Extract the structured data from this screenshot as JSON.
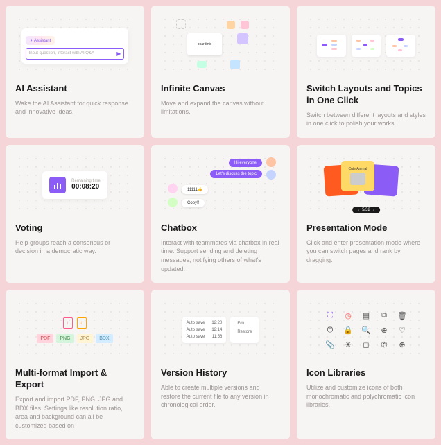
{
  "cards": {
    "ai": {
      "title": "AI Assistant",
      "desc": "Wake the AI Assistant for quick response and innovative ideas.",
      "chip": "✦ Assistant",
      "placeholder": "Input question, interact with AI Q&A"
    },
    "canvas": {
      "title": "Infinite Canvas",
      "desc": "Move and expand the canvas without limitations.",
      "center_label": "boardmix"
    },
    "layouts": {
      "title": "Switch Layouts and Topics in One Click",
      "desc": "Switch between different layouts and styles in one click to polish your works."
    },
    "voting": {
      "title": "Voting",
      "desc": "Help groups reach a consensus or decision in a democratic way.",
      "label": "Remaining time",
      "time": "00:08:20"
    },
    "chatbox": {
      "title": "Chatbox",
      "desc": "Interact with teammates via chatbox in real time. Support sending and deleting messages, notifying others of what's updated.",
      "msg1": "Hi everyone",
      "msg2": "Let's discuss the topic",
      "msg3": "11111👍",
      "msg4": "Copy!!"
    },
    "presentation": {
      "title": "Presentation Mode",
      "desc": "Click and enter presentation mode where you can switch pages and rank by dragging.",
      "slide_label": "Cute Animal",
      "pager": "5/32"
    },
    "export": {
      "title": "Multi-format Import & Export",
      "desc": "Export and import PDF, PNG, JPG and BDX files. Settings like resolution ratio, area and background can all be customized based on",
      "tags": [
        "PDF",
        "PNG",
        "JPG",
        "BDX"
      ]
    },
    "version": {
      "title": "Version History",
      "desc": "Able to create multiple versions and restore the current file to any version in chronological order.",
      "rows": [
        {
          "label": "Auto save",
          "time": "12:20"
        },
        {
          "label": "Auto save",
          "time": "12:14"
        },
        {
          "label": "Auto save",
          "time": "11:56"
        }
      ],
      "menu": [
        "Edit",
        "Restore"
      ]
    },
    "icons": {
      "title": "Icon Libraries",
      "desc": "Utilize and customize icons of both monochromatic and polychromatic icon libraries."
    }
  }
}
